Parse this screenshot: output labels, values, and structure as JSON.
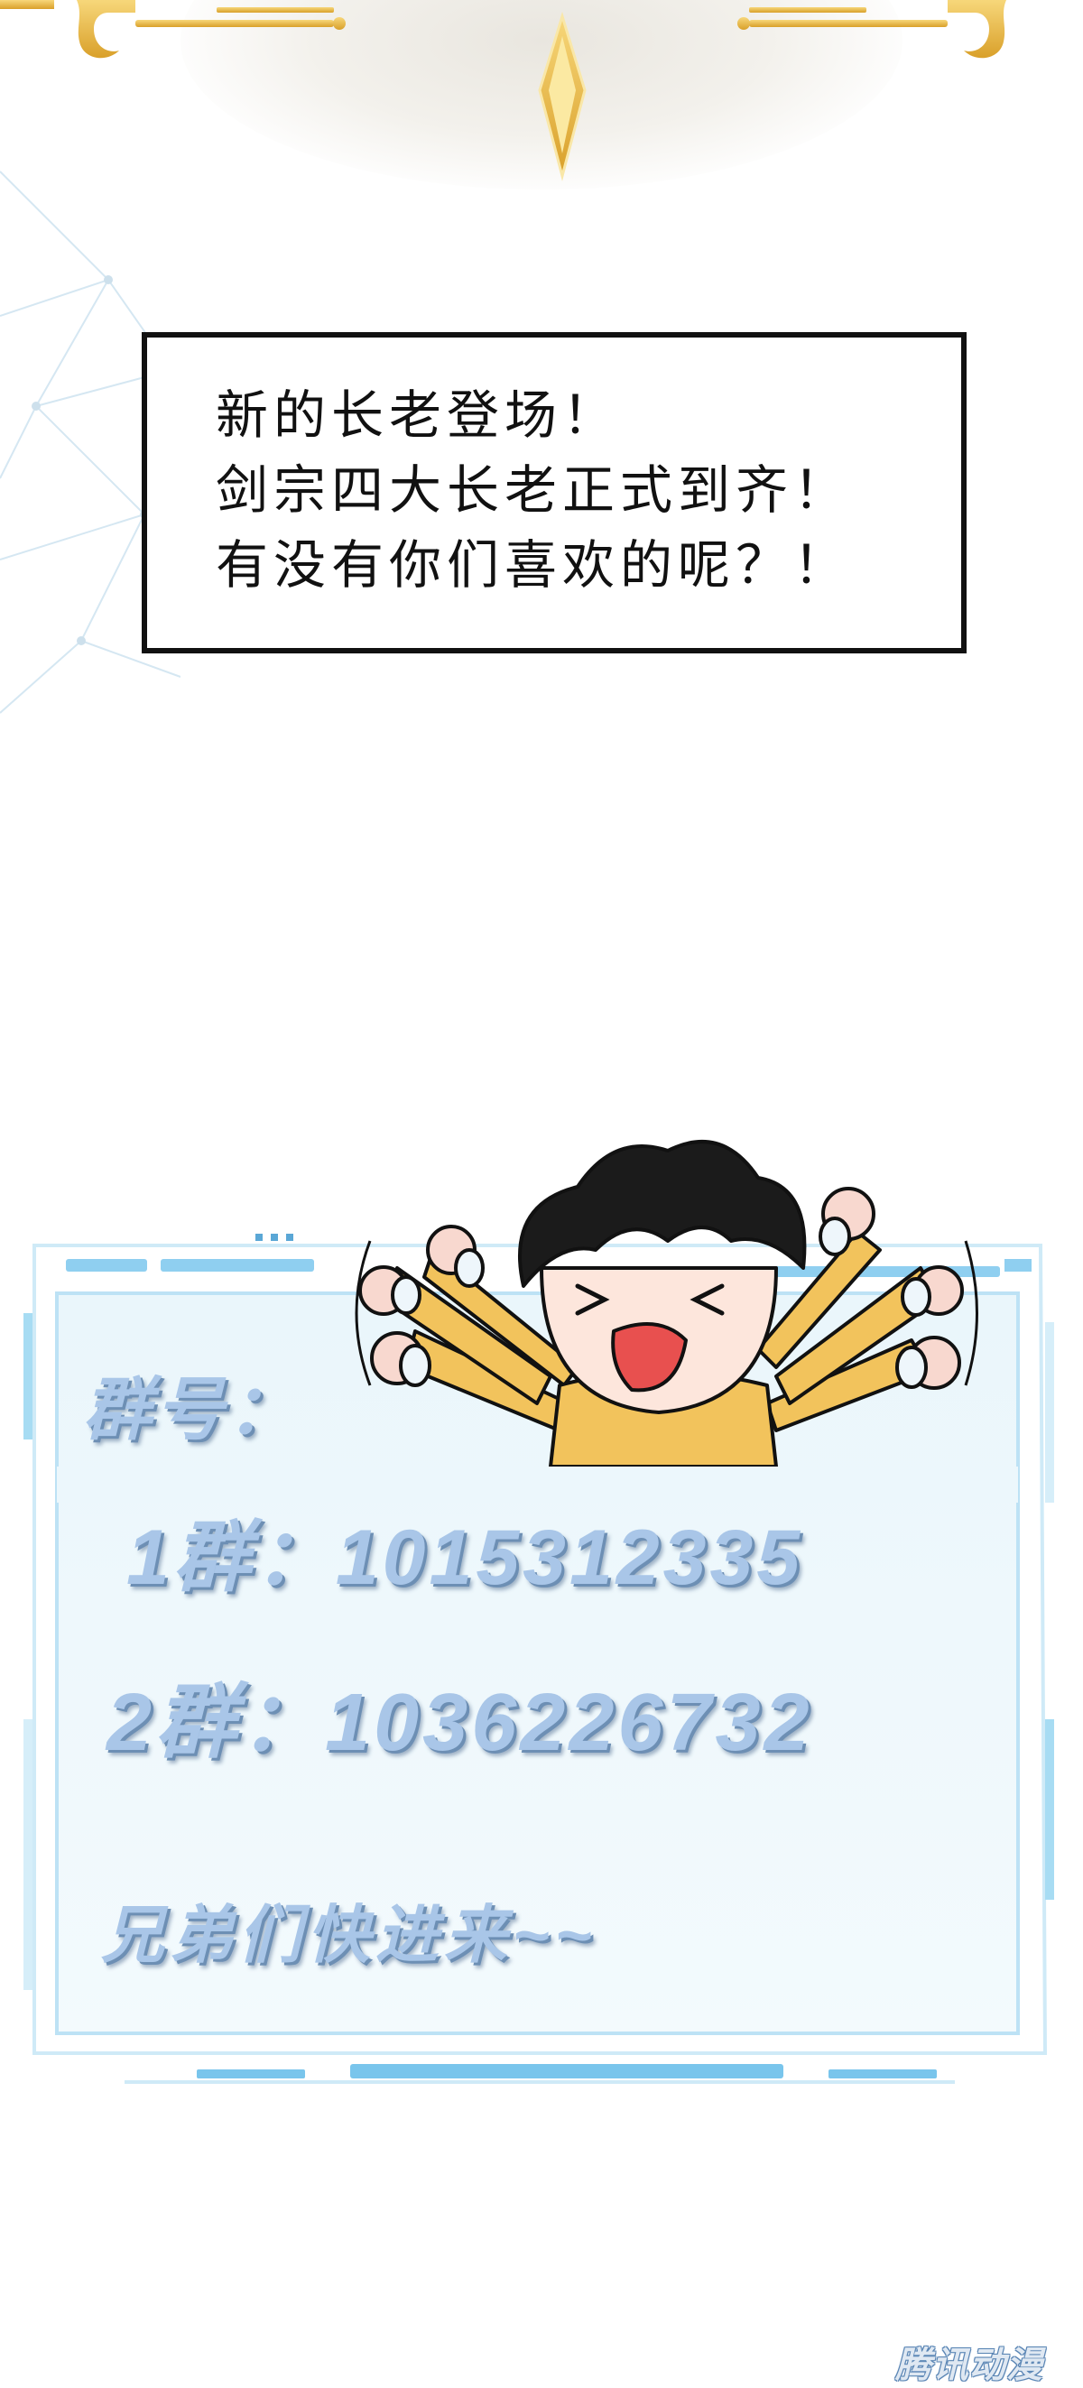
{
  "dialogue": {
    "line1": "新的长老登场！",
    "line2": "剑宗四大长老正式到齐！",
    "line3": "有没有你们喜欢的呢？！"
  },
  "panel": {
    "group_label": "群号：",
    "group1": "1群：1015312335",
    "group2": "2群：1036226732",
    "invite": "兄弟们快进来~~"
  },
  "watermark": "腾讯动漫",
  "colors": {
    "gold": "#e7b94a",
    "panel_border": "#bfe3f6",
    "panel_fill": "#eef8fc",
    "text_blue": "#a9c6e8",
    "outline": "#111111",
    "hair": "#1b1b1b",
    "sleeve": "#f2c35c"
  },
  "icons": [
    "gold-ornament-icon",
    "chibi-character-icon"
  ]
}
